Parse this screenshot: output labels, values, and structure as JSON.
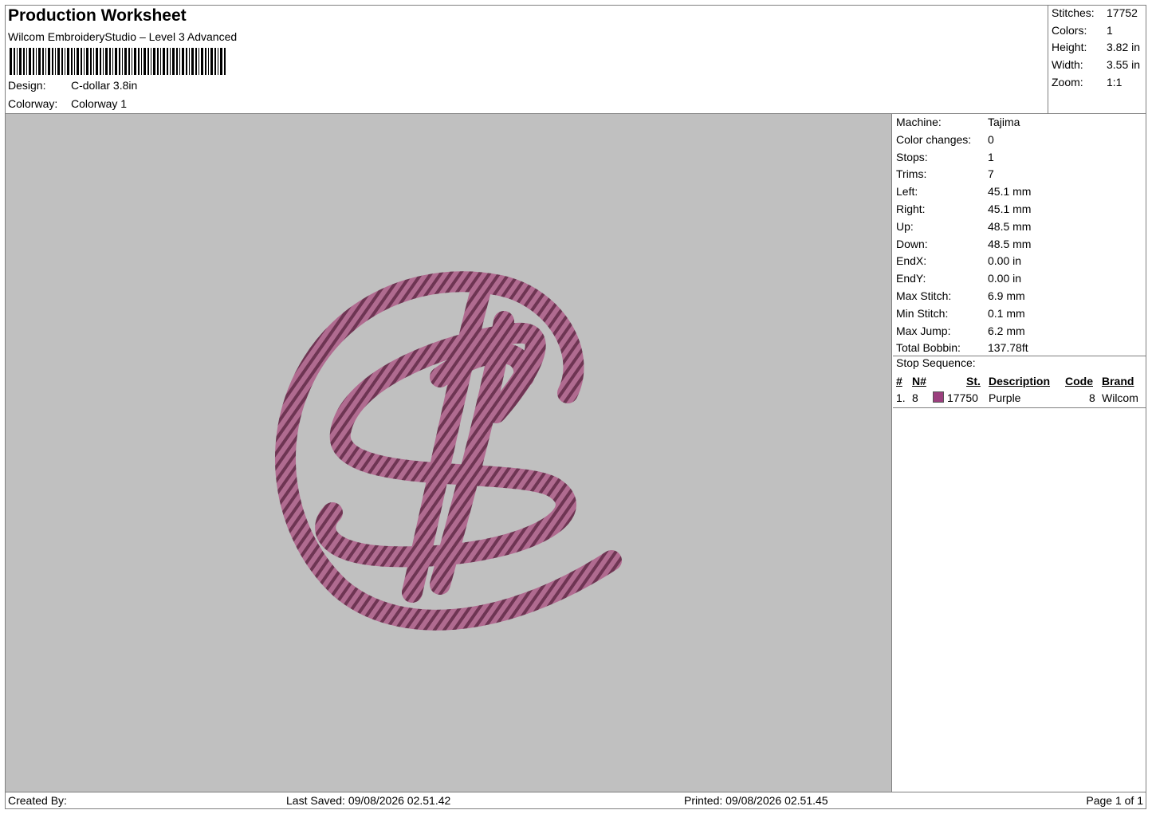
{
  "header": {
    "title": "Production Worksheet",
    "subtitle": "Wilcom EmbroideryStudio – Level 3 Advanced",
    "design_label": "Design:",
    "design_value": "C-dollar 3.8in",
    "colorway_label": "Colorway:",
    "colorway_value": "Colorway 1"
  },
  "summary": [
    {
      "label": "Stitches:",
      "value": "17752"
    },
    {
      "label": "Colors:",
      "value": "1"
    },
    {
      "label": "Height:",
      "value": "3.82 in"
    },
    {
      "label": "Width:",
      "value": "3.55 in"
    },
    {
      "label": "Zoom:",
      "value": "1:1"
    }
  ],
  "details": [
    {
      "label": "Machine:",
      "value": "Tajima"
    },
    {
      "label": "Color changes:",
      "value": "0"
    },
    {
      "label": "Stops:",
      "value": "1"
    },
    {
      "label": "Trims:",
      "value": "7"
    },
    {
      "label": "Left:",
      "value": "45.1 mm"
    },
    {
      "label": "Right:",
      "value": "45.1 mm"
    },
    {
      "label": "Up:",
      "value": "48.5 mm"
    },
    {
      "label": "Down:",
      "value": "48.5 mm"
    },
    {
      "label": "EndX:",
      "value": "0.00 in"
    },
    {
      "label": "EndY:",
      "value": "0.00 in"
    },
    {
      "label": "Max Stitch:",
      "value": "6.9 mm"
    },
    {
      "label": "Min Stitch:",
      "value": "0.1 mm"
    },
    {
      "label": "Max Jump:",
      "value": "6.2 mm"
    },
    {
      "label": "Total Bobbin:",
      "value": "137.78ft"
    }
  ],
  "stop_sequence": {
    "title": "Stop Sequence:",
    "headers": {
      "num": "#",
      "needle": "N#",
      "stitches": "St.",
      "description": "Description",
      "code": "Code",
      "brand": "Brand"
    },
    "rows": [
      {
        "num": "1.",
        "needle": "8",
        "color": "#9b3f7e",
        "stitches": "17750",
        "description": "Purple",
        "code": "8",
        "brand": "Wilcom"
      }
    ]
  },
  "design_colors": {
    "thread": "#b06b90",
    "thread_dark": "#6e3553",
    "background": "#c0c0c0"
  },
  "footer": {
    "created_by": "Created By:",
    "last_saved": "Last Saved: 09/08/2026 02.51.42",
    "printed": "Printed: 09/08/2026 02.51.45",
    "page": "Page 1 of 1"
  }
}
